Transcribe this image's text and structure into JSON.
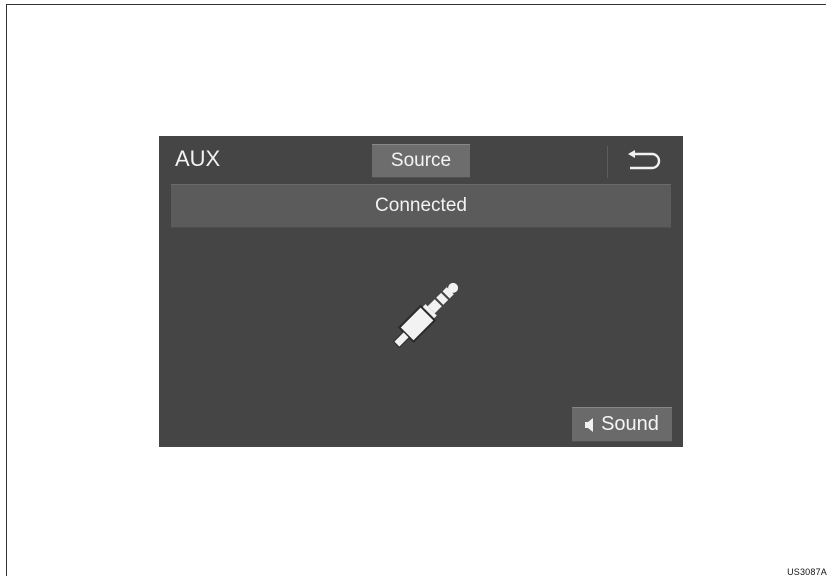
{
  "header": {
    "title": "AUX",
    "source_label": "Source"
  },
  "status": {
    "text": "Connected"
  },
  "footer": {
    "sound_label": "Sound"
  },
  "icons": {
    "back": "back-arrow-icon",
    "aux": "aux-plug-icon",
    "speaker": "speaker-icon"
  },
  "figure_code": "US3087A",
  "colors": {
    "screen_bg": "#454545",
    "button_bg": "#6d6d6d",
    "status_bg": "#5b5b5b",
    "text": "#f2f2f2"
  }
}
